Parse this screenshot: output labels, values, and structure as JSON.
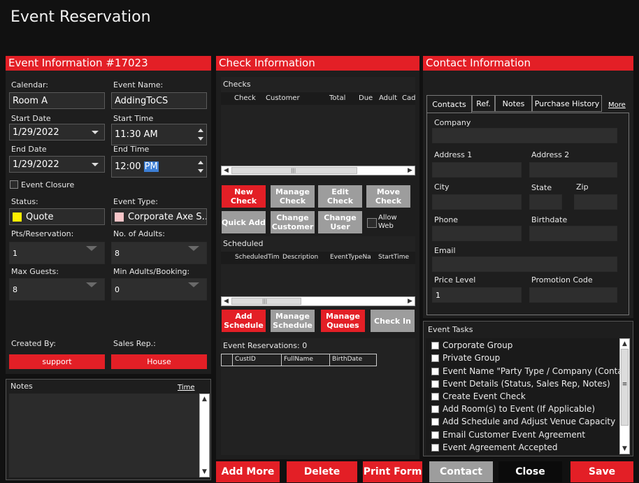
{
  "app": {
    "title": "Event Reservation"
  },
  "colors": {
    "accent": "#e31f26",
    "panel": "#1e1e1e",
    "background": "#111111",
    "status_quote": "#ffef00",
    "type_corporate": "#f7c5c8"
  },
  "event_info": {
    "header": "Event Information #17023",
    "calendar_label": "Calendar:",
    "calendar_value": "Room A",
    "event_name_label": "Event Name:",
    "event_name_value": "AddingToCS",
    "start_date_label": "Start Date",
    "start_date_value": "1/29/2022",
    "start_time_label": "Start Time",
    "start_time_value": "11:30 AM",
    "end_date_label": "End Date",
    "end_date_value": "1/29/2022",
    "end_time_label": "End Time",
    "end_time_prefix": "12:00 ",
    "end_time_selected": "PM",
    "event_closure_label": "Event Closure",
    "status_label": "Status:",
    "status_value": "Quote",
    "event_type_label": "Event Type:",
    "event_type_value": "Corporate Axe S...",
    "pts_label": "Pts/Reservation:",
    "pts_value": "1",
    "adults_label": "No. of Adults:",
    "adults_value": "8",
    "max_guests_label": "Max Guests:",
    "max_guests_value": "8",
    "min_adults_label": "Min Adults/Booking:",
    "min_adults_value": "0",
    "created_by_label": "Created By:",
    "created_by_value": "support",
    "sales_rep_label": "Sales Rep.:",
    "sales_rep_value": "House"
  },
  "notes": {
    "title": "Notes",
    "time_link": "Time"
  },
  "check_info": {
    "header": "Check Information",
    "checks_title": "Checks",
    "checks_columns": [
      "Check",
      "Customer",
      "Total",
      "Due",
      "Adult",
      "Cad"
    ],
    "buttons": {
      "new_check": "New Check",
      "manage_check": "Manage Check",
      "edit_check": "Edit Check",
      "move_check": "Move Check",
      "quick_add": "Quick Add",
      "change_customer": "Change Customer",
      "change_user": "Change User",
      "allow_web": "Allow Web"
    },
    "scheduled_title": "Scheduled",
    "scheduled_columns": [
      "ScheduledTim",
      "Description",
      "EventTypeNa",
      "StartTime"
    ],
    "sched_buttons": {
      "add_schedule": "Add Schedule",
      "manage_schedule": "Manage Schedule",
      "manage_queues": "Manage Queues",
      "check_in": "Check In"
    },
    "reservations_title": "Event Reservations: 0",
    "reservations_columns": [
      "CustID",
      "FullName",
      "BirthDate"
    ]
  },
  "contact_info": {
    "header": "Contact Information",
    "tabs": [
      "Contacts",
      "Ref.",
      "Notes",
      "Purchase History"
    ],
    "more_link": "More",
    "company_label": "Company",
    "address1_label": "Address 1",
    "address2_label": "Address 2",
    "city_label": "City",
    "state_label": "State",
    "zip_label": "Zip",
    "phone_label": "Phone",
    "birthdate_label": "Birthdate",
    "email_label": "Email",
    "price_level_label": "Price Level",
    "price_level_value": "1",
    "promotion_code_label": "Promotion Code"
  },
  "event_tasks": {
    "title": "Event Tasks",
    "items": [
      "Corporate Group",
      "Private Group",
      "Event Name \"Party Type / Company (Contact Na",
      "Event Details (Status, Sales Rep, Notes)",
      "Create Event Check",
      "Add Room(s) to Event (If Applicable)",
      "Add Schedule and Adjust Venue Capacity",
      "Email Customer Event Agreement",
      "Event Agreement Accepted"
    ]
  },
  "footer": {
    "add_more": "Add More",
    "delete": "Delete",
    "print_form": "Print Form",
    "contact": "Contact",
    "close": "Close",
    "save": "Save"
  }
}
